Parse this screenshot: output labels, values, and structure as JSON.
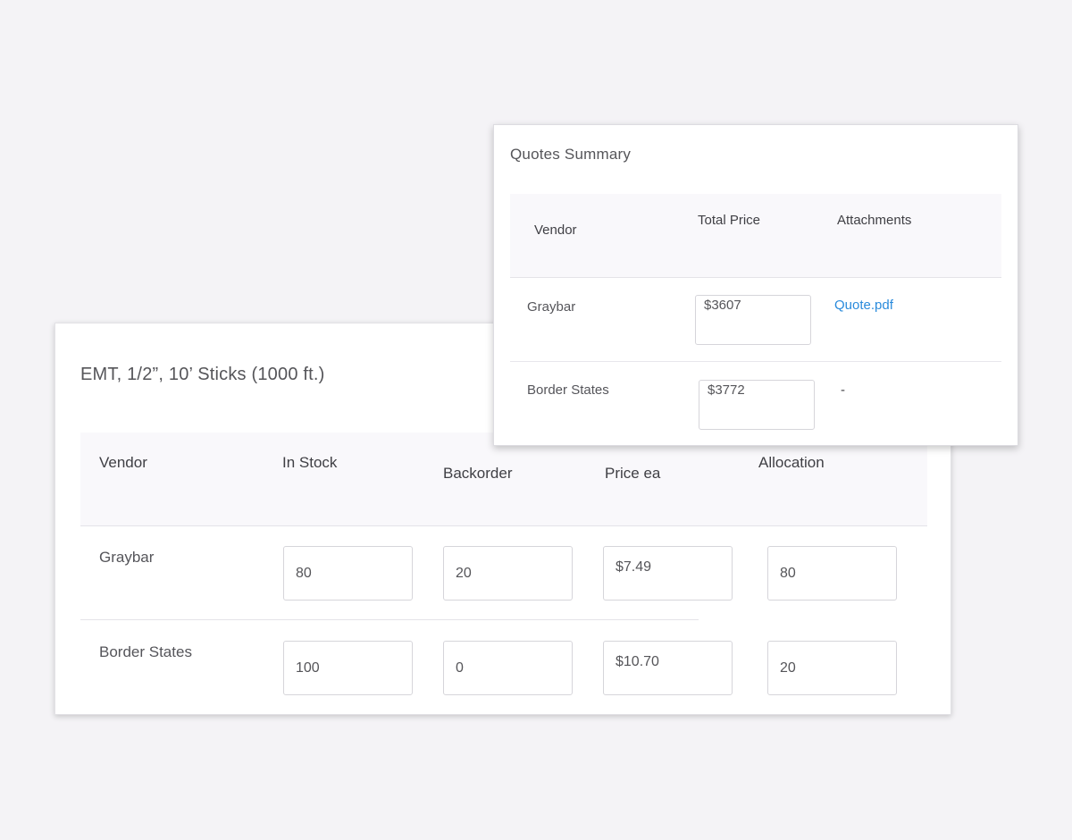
{
  "line_item": {
    "title": "EMT, 1/2”, 10’ Sticks (1000 ft.)",
    "columns": {
      "vendor": "Vendor",
      "in_stock": "In Stock",
      "backorder": "Backorder",
      "price_ea": "Price ea",
      "allocation": "Allocation"
    },
    "rows": [
      {
        "vendor": "Graybar",
        "in_stock": "80",
        "backorder": "20",
        "price_ea": "$7.49",
        "allocation": "80"
      },
      {
        "vendor": "Border States",
        "in_stock": "100",
        "backorder": "0",
        "price_ea": "$10.70",
        "allocation": "20"
      }
    ]
  },
  "quotes_summary": {
    "title": "Quotes Summary",
    "columns": {
      "vendor": "Vendor",
      "total_price": "Total Price",
      "attachments": "Attachments"
    },
    "rows": [
      {
        "vendor": "Graybar",
        "total_price": "$3607",
        "attachment": "Quote.pdf"
      },
      {
        "vendor": "Border States",
        "total_price": "$3772",
        "attachment": "-"
      }
    ]
  },
  "colors": {
    "background": "#f4f3f6",
    "link": "#2a8bdc",
    "header_band": "#f9f8fb"
  }
}
